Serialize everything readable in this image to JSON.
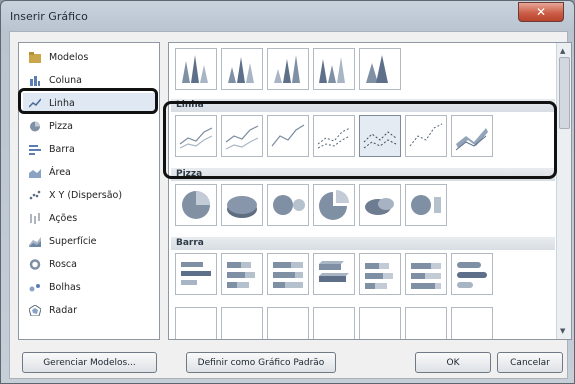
{
  "window": {
    "title": "Inserir Gráfico",
    "close_label": "✕"
  },
  "categories": [
    {
      "label": "Modelos",
      "icon": "folder-icon"
    },
    {
      "label": "Coluna",
      "icon": "column-chart-icon"
    },
    {
      "label": "Linha",
      "icon": "line-chart-icon",
      "selected": true
    },
    {
      "label": "Pizza",
      "icon": "pie-chart-icon"
    },
    {
      "label": "Barra",
      "icon": "bar-chart-icon"
    },
    {
      "label": "Área",
      "icon": "area-chart-icon"
    },
    {
      "label": "X Y (Dispersão)",
      "icon": "scatter-chart-icon"
    },
    {
      "label": "Ações",
      "icon": "stock-chart-icon"
    },
    {
      "label": "Superfície",
      "icon": "surface-chart-icon"
    },
    {
      "label": "Rosca",
      "icon": "doughnut-chart-icon"
    },
    {
      "label": "Bolhas",
      "icon": "bubble-chart-icon"
    },
    {
      "label": "Radar",
      "icon": "radar-chart-icon"
    }
  ],
  "sections": {
    "linha": "Linha",
    "pizza": "Pizza",
    "barra": "Barra"
  },
  "buttons": {
    "manage_templates": "Gerenciar Modelos...",
    "set_default": "Definir como Gráfico Padrão",
    "ok": "OK",
    "cancel": "Cancelar"
  },
  "colors": {
    "selection_outline": "#111111",
    "selected_category_bg": "#dfe8f3"
  }
}
